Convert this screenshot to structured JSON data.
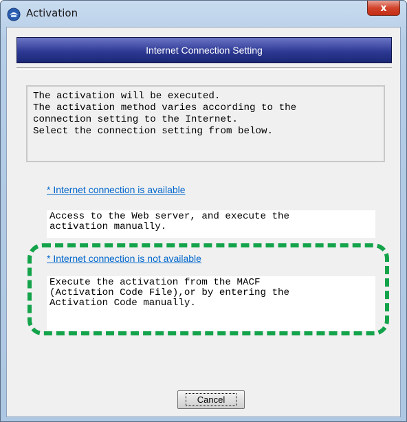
{
  "window": {
    "title": "Activation",
    "close_label": "x"
  },
  "header": {
    "title": "Internet Connection Setting"
  },
  "message": {
    "lines": [
      "The activation will be executed.",
      "The activation method varies according to the",
      "connection setting to the Internet.",
      "Select the connection setting from below."
    ]
  },
  "options": [
    {
      "link": "* Internet connection is available",
      "description": [
        "Access to the Web server, and execute the",
        "activation manually."
      ]
    },
    {
      "link": "* Internet connection is not available",
      "description": [
        "Execute the activation from the MACF",
        "(Activation Code File),or by entering the",
        "Activation Code manually."
      ]
    }
  ],
  "buttons": {
    "cancel": "Cancel"
  },
  "colors": {
    "highlight": "#13a34a",
    "link": "#0066cc",
    "header": "#2e3a94"
  }
}
